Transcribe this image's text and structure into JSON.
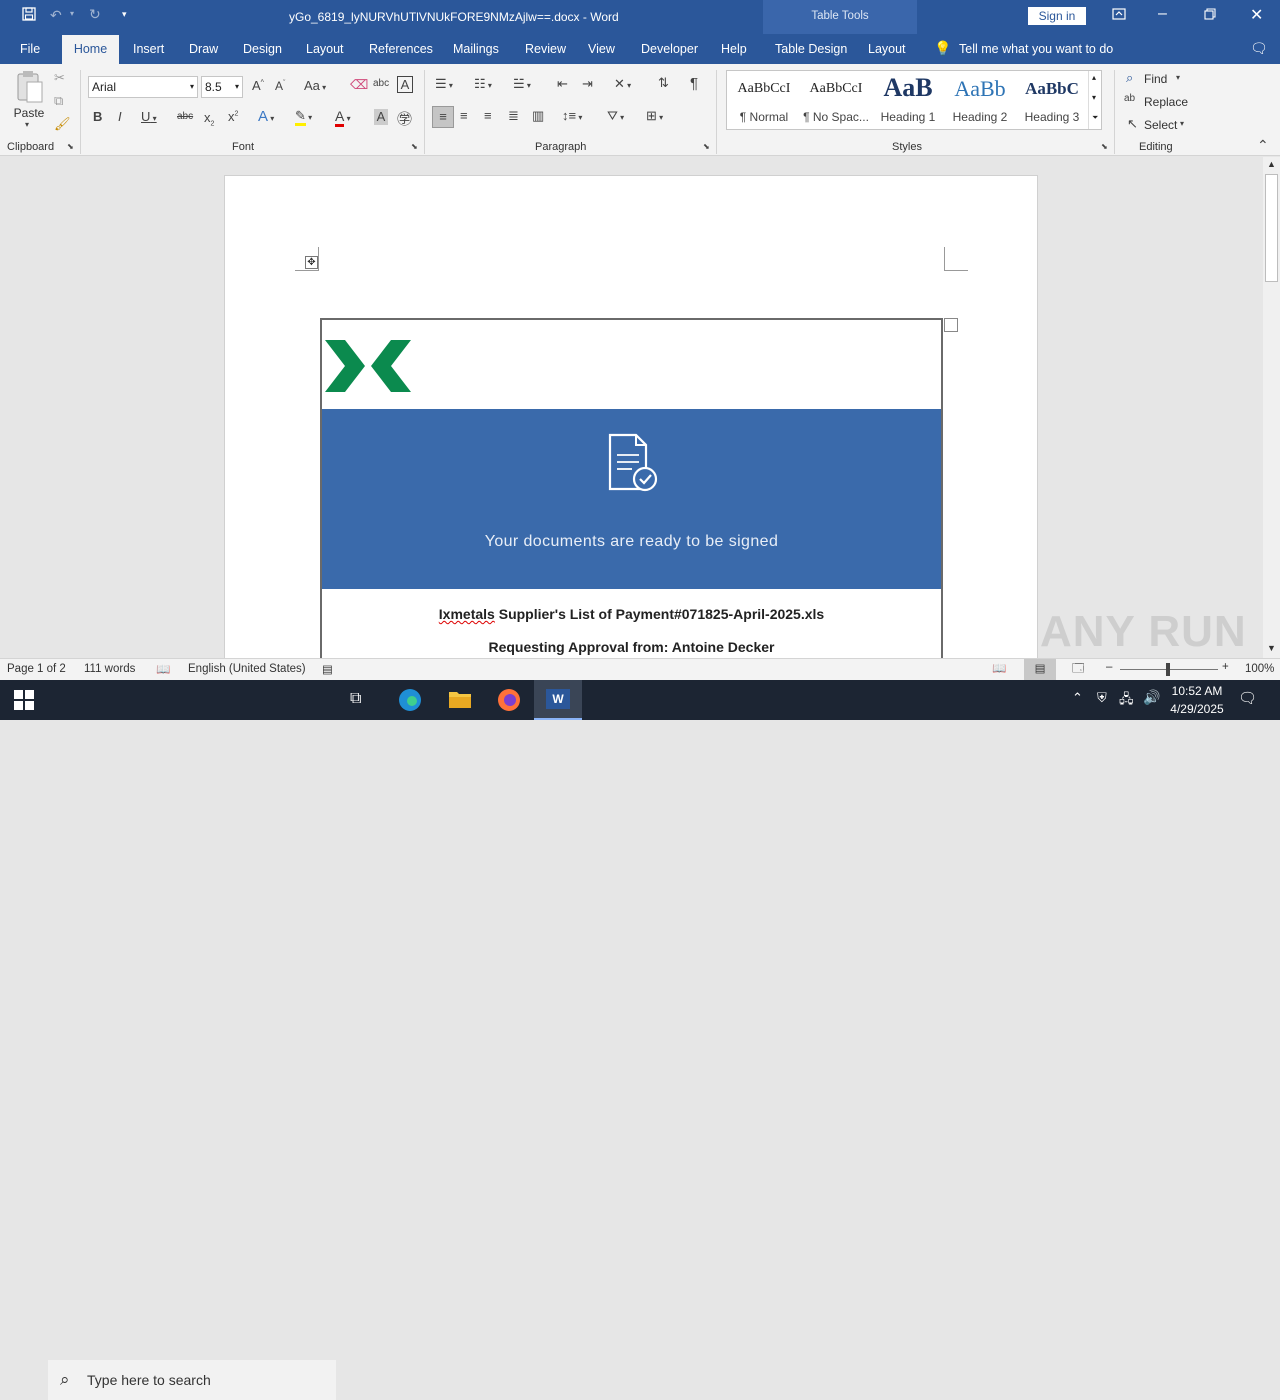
{
  "titlebar": {
    "title": "yGo_6819_lyNURVhUTlVNUkFORE9NMzAjlw==.docx  -  Word",
    "table_tools": "Table Tools",
    "sign_in": "Sign in"
  },
  "tabs": {
    "file": "File",
    "home": "Home",
    "insert": "Insert",
    "draw": "Draw",
    "design": "Design",
    "layout": "Layout",
    "references": "References",
    "mailings": "Mailings",
    "review": "Review",
    "view": "View",
    "developer": "Developer",
    "help": "Help",
    "table_design": "Table Design",
    "table_layout": "Layout",
    "tell_me": "Tell me what you want to do"
  },
  "ribbon": {
    "paste": "Paste",
    "clipboard": "Clipboard",
    "font_group": "Font",
    "paragraph_group": "Paragraph",
    "styles_group": "Styles",
    "editing_group": "Editing",
    "font_name": "Arial",
    "font_size": "8.5",
    "find": "Find",
    "replace": "Replace",
    "select": "Select",
    "styles": [
      {
        "sample": "AaBbCcI",
        "name": "¶ Normal"
      },
      {
        "sample": "AaBbCcI",
        "name": "¶ No Spac..."
      },
      {
        "sample": "AaB",
        "name": "Heading 1"
      },
      {
        "sample": "AaBb",
        "name": "Heading 2"
      },
      {
        "sample": "AaBbC",
        "name": "Heading 3"
      }
    ]
  },
  "document": {
    "banner_text": "Your documents  are ready to be signed",
    "file_line_prefix": "Ixmetals",
    "file_line_rest": "  Supplier's  List  of  Payment#071825-April-2025.xls",
    "approval_line": "Requesting Approval from: Antoine Decker",
    "brand_color": "#0b8a4e",
    "banner_color": "#3a6aab"
  },
  "status": {
    "page": "Page 1 of 2",
    "words": "111 words",
    "language": "English (United States)",
    "zoom": "100%"
  },
  "taskbar": {
    "search_placeholder": "Type here to search",
    "time": "10:52 AM",
    "date": "4/29/2025"
  },
  "watermark": "ANY RUN"
}
